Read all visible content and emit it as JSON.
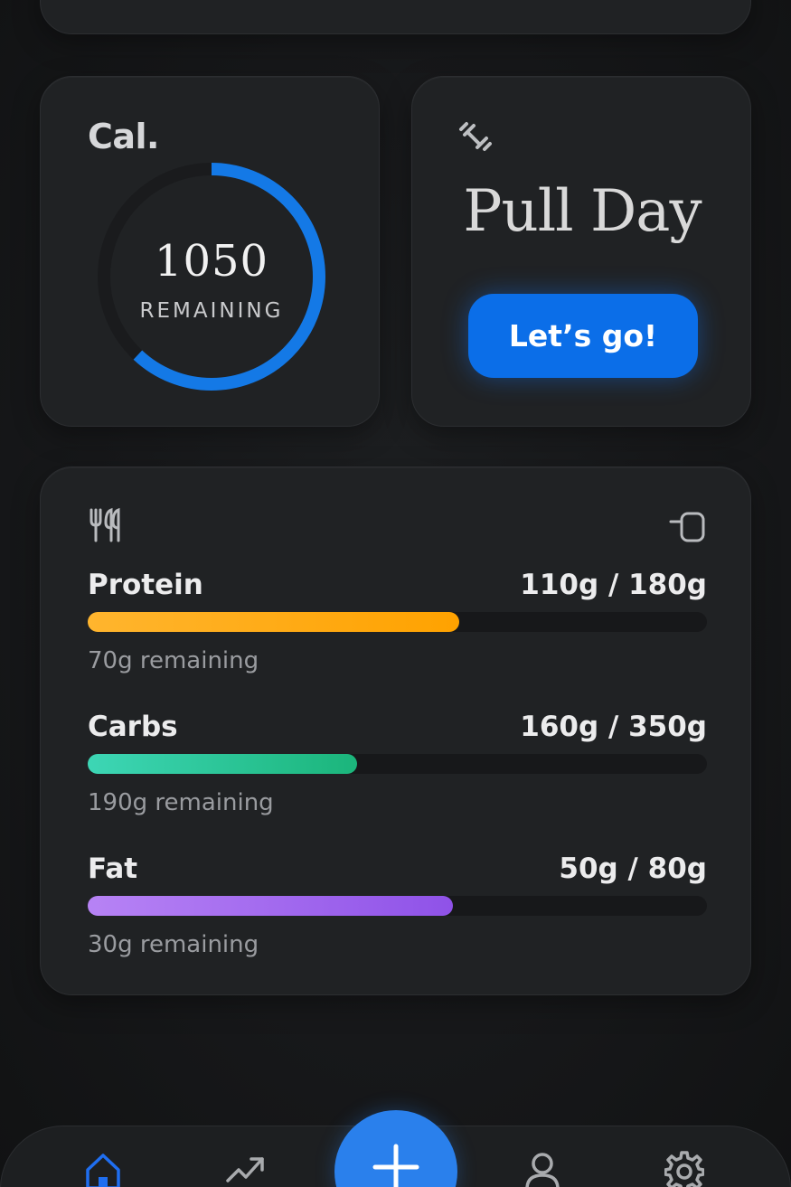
{
  "calories": {
    "title": "Cal.",
    "remaining_value": "1050",
    "remaining_label": "REMAINING",
    "ring_fraction": 0.62,
    "ring_color": "#1479e6"
  },
  "workout": {
    "icon": "dumbbell-icon",
    "title": "Pull Day",
    "button_label": "Let’s go!",
    "button_color": "#0b6ee8"
  },
  "macros": {
    "icons": {
      "left": "fork-knife-icon",
      "right": "expand-icon"
    },
    "items": [
      {
        "name": "Protein",
        "amount": "110g / 180g",
        "remaining": "70g remaining",
        "progress": 0.6,
        "color_start": "#ffb52e",
        "color_end": "#ffa200"
      },
      {
        "name": "Carbs",
        "amount": "160g / 350g",
        "remaining": "190g remaining",
        "progress": 0.435,
        "color_start": "#3dd6b5",
        "color_end": "#1bb57b"
      },
      {
        "name": "Fat",
        "amount": "50g / 80g",
        "remaining": "30g remaining",
        "progress": 0.59,
        "color_start": "#b783f5",
        "color_end": "#8f52e8"
      }
    ]
  },
  "nav": {
    "items": [
      {
        "name": "home-icon",
        "active": true
      },
      {
        "name": "trends-icon",
        "active": false
      },
      {
        "name": "add-icon",
        "active": false
      },
      {
        "name": "profile-icon",
        "active": false
      },
      {
        "name": "settings-icon",
        "active": false
      }
    ],
    "active_color": "#1f6ef0",
    "inactive_color": "#a9abae"
  }
}
